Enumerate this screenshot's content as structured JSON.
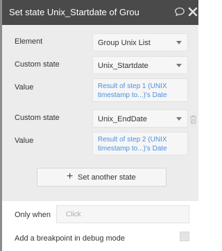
{
  "header": {
    "title": "Set state Unix_Startdate of Grou"
  },
  "element": {
    "label": "Element",
    "value": "Group Unix List"
  },
  "states": [
    {
      "custom_state_label": "Custom state",
      "custom_state_value": "Unix_Startdate",
      "value_label": "Value",
      "value_expression": "Result of step 1 (UNIX timestamp to...)'s Date"
    },
    {
      "custom_state_label": "Custom state",
      "custom_state_value": "Unix_EndDate",
      "value_label": "Value",
      "value_expression": "Result of step 2 (UNIX timestamp to...)'s Date"
    }
  ],
  "add_button": {
    "icon": "+",
    "label": "Set another state"
  },
  "only_when": {
    "label": "Only when",
    "placeholder": "Click"
  },
  "breakpoint": {
    "label": "Add a breakpoint in debug mode"
  },
  "colors": {
    "header_bg": "#4a4a4a",
    "body_bg": "#ececec",
    "expression": "#4a90e2"
  }
}
